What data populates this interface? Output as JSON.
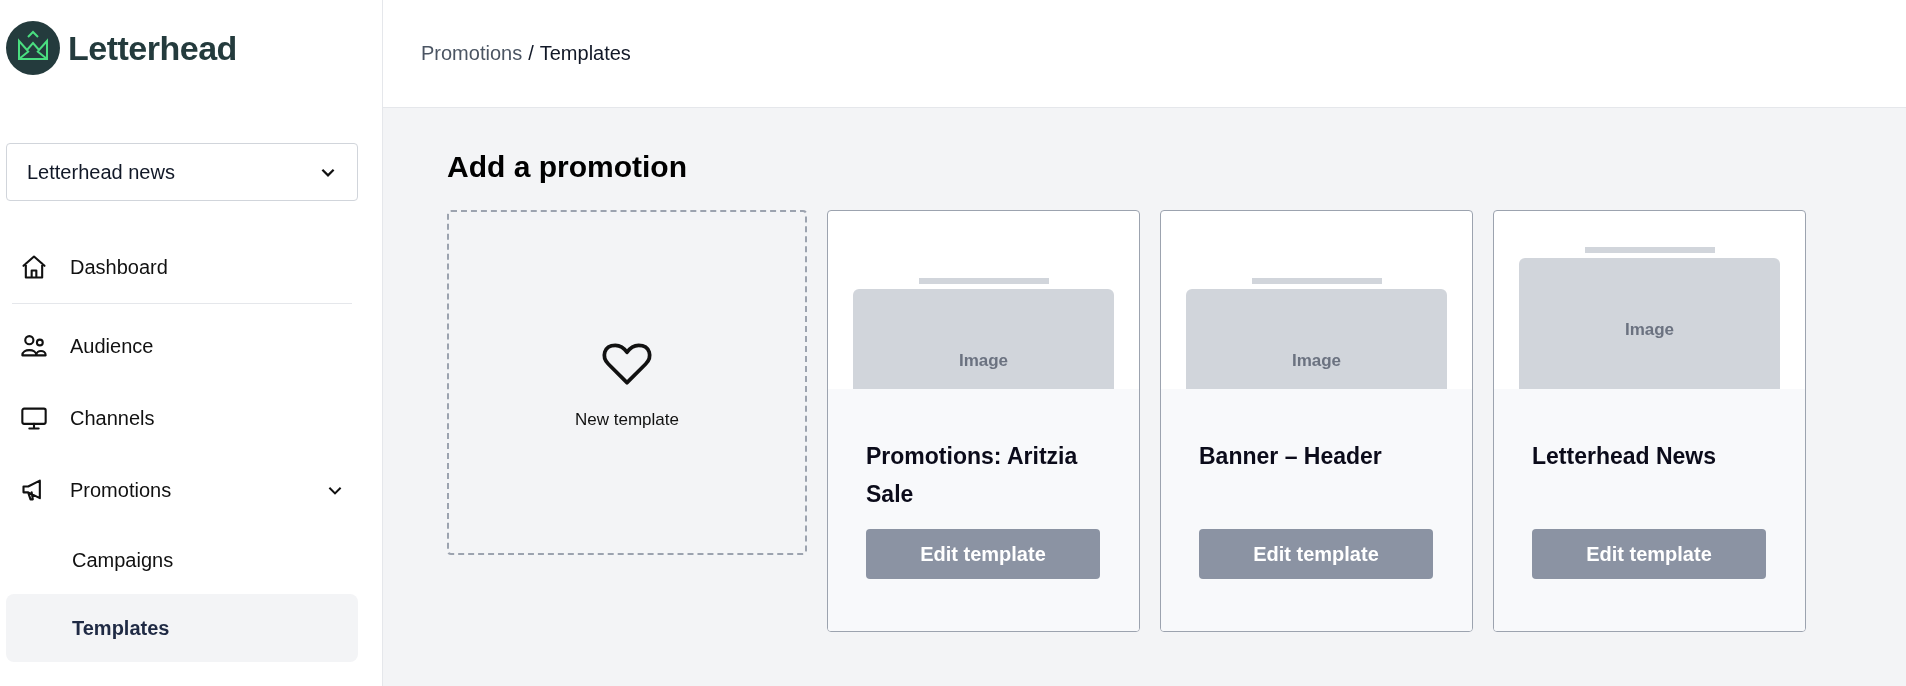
{
  "brand": {
    "name": "Letterhead"
  },
  "workspace_select": {
    "value": "Letterhead news"
  },
  "sidebar": {
    "items": [
      {
        "label": "Dashboard",
        "selected": false
      },
      {
        "label": "Audience",
        "selected": false
      },
      {
        "label": "Channels",
        "selected": false
      },
      {
        "label": "Promotions",
        "selected": false,
        "expanded": true,
        "children": [
          {
            "label": "Campaigns",
            "selected": false
          },
          {
            "label": "Templates",
            "selected": true
          }
        ]
      }
    ]
  },
  "breadcrumb": [
    {
      "label": "Promotions",
      "current": false
    },
    {
      "label": "/",
      "current": true
    },
    {
      "label": "Templates",
      "current": true
    }
  ],
  "heading": "Add a promotion",
  "new_template": {
    "label": "New template"
  },
  "templates": [
    {
      "kind": "compact",
      "image_label": "Image",
      "title": "Promotions: Aritzia Sale",
      "button": "Edit template"
    },
    {
      "kind": "compact",
      "image_label": "Image",
      "title": "Banner – Header",
      "button": "Edit template"
    },
    {
      "kind": "tall",
      "image_label": "Image",
      "title": "Letterhead News",
      "button": "Edit template"
    }
  ]
}
